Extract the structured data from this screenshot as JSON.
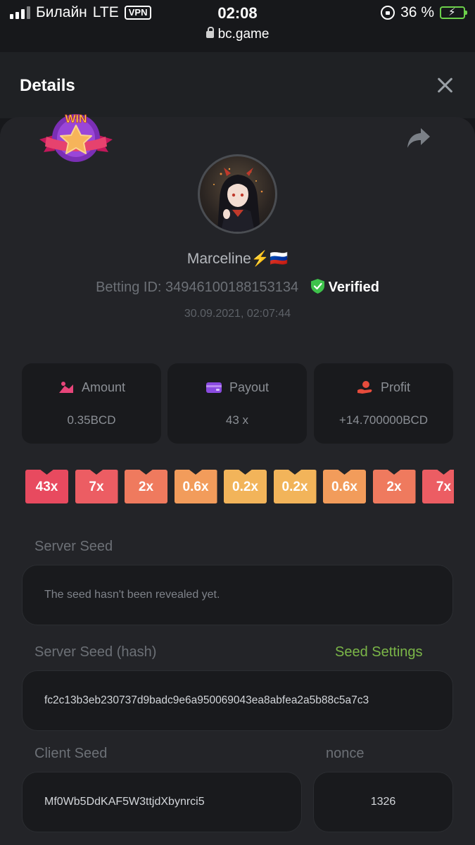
{
  "status_bar": {
    "carrier": "Билайн",
    "network": "LTE",
    "vpn": "VPN",
    "time": "02:08",
    "url": "bc.game",
    "battery": "36 %",
    "battery_level": 0.36
  },
  "header": {
    "title": "Details"
  },
  "bet": {
    "badge": "WIN",
    "username": "Marceline",
    "username_emoji": "⚡️🇷🇺",
    "betting_id_label": "Betting ID:",
    "betting_id": "34946100188153134",
    "verified": "Verified",
    "datetime": "30.09.2021, 02:07:44"
  },
  "stats": [
    {
      "label": "Amount",
      "value": "0.35BCD",
      "icon": "amount-icon"
    },
    {
      "label": "Payout",
      "value": "43 x",
      "icon": "wallet-icon"
    },
    {
      "label": "Profit",
      "value": "+14.700000BCD",
      "icon": "profit-icon"
    }
  ],
  "multipliers": [
    {
      "label": "43x",
      "color": "#e84a5f"
    },
    {
      "label": "7x",
      "color": "#ec5d63"
    },
    {
      "label": "2x",
      "color": "#ef7a5e"
    },
    {
      "label": "0.6x",
      "color": "#f29c5b"
    },
    {
      "label": "0.2x",
      "color": "#f2b45a"
    },
    {
      "label": "0.2x",
      "color": "#f2b45a"
    },
    {
      "label": "0.6x",
      "color": "#f29c5b"
    },
    {
      "label": "2x",
      "color": "#ef7a5e"
    },
    {
      "label": "7x",
      "color": "#ec5d63"
    }
  ],
  "server_seed": {
    "label": "Server Seed",
    "value": "The seed hasn't been revealed yet."
  },
  "server_seed_hash": {
    "label": "Server Seed (hash)",
    "link": "Seed Settings",
    "value": "fc2c13b3eb230737d9badc9e6a950069043ea8abfea2a5b88c5a7c3"
  },
  "client_seed": {
    "label": "Client Seed",
    "value": "Mf0Wb5DdKAF5W3ttjdXbynrci5"
  },
  "nonce": {
    "label": "nonce",
    "value": "1326"
  },
  "colors": {
    "accent_green": "#7bb648",
    "verified_green": "#3ec24b",
    "background": "#17181b",
    "card": "#232428"
  }
}
